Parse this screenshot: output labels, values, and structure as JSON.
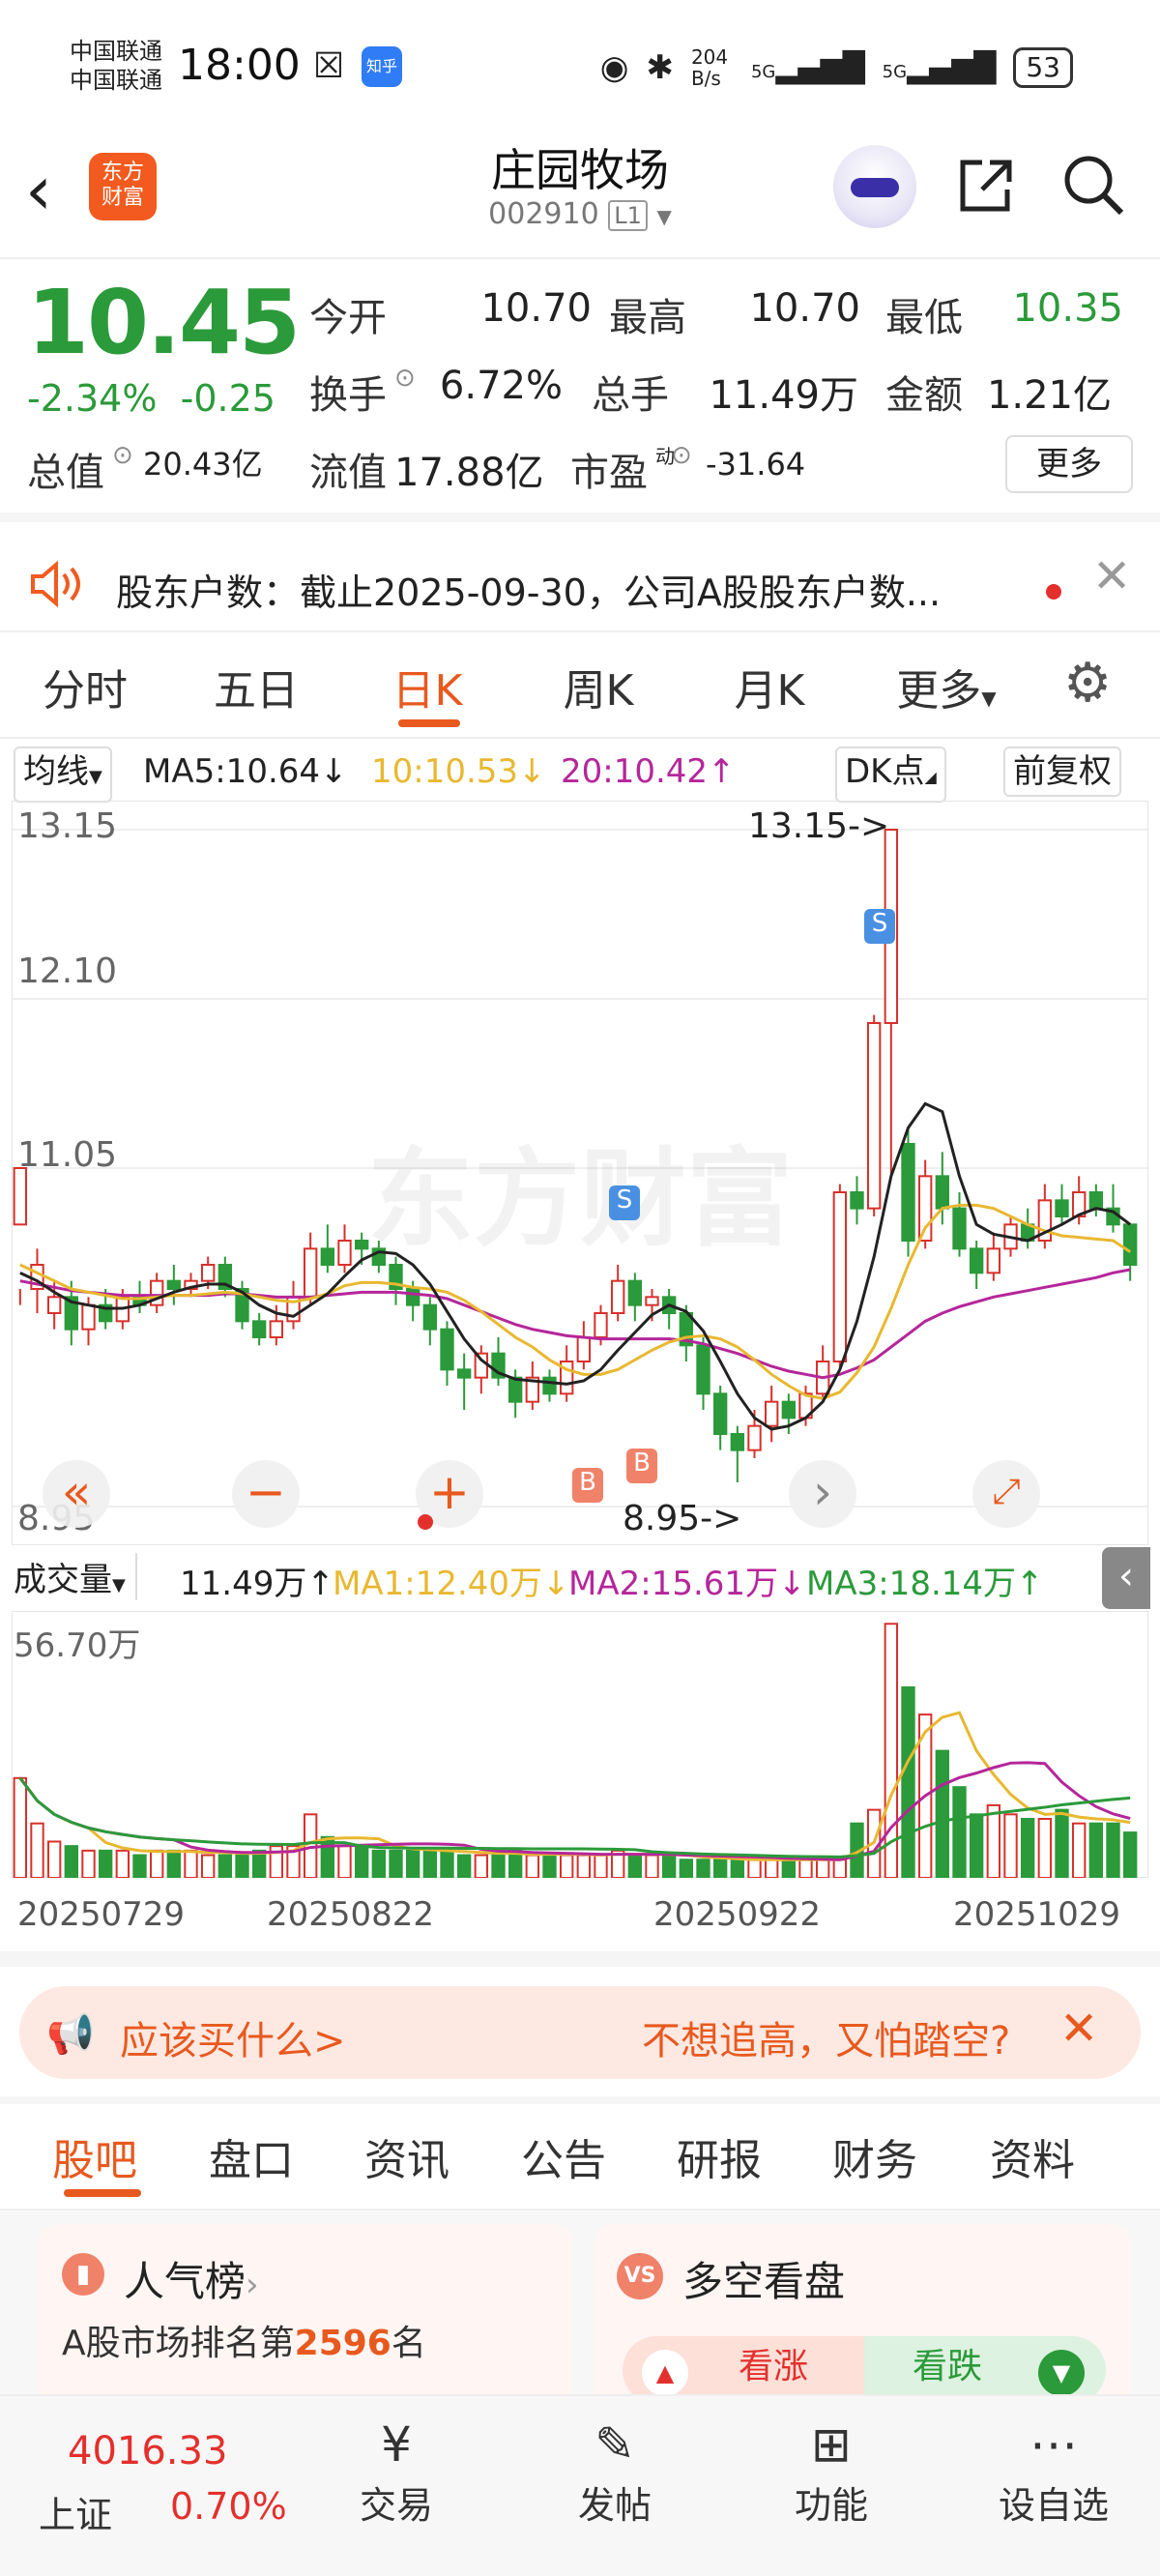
{
  "status_bar": {
    "carrier1": "中国联通",
    "carrier2": "中国联通",
    "time": "18:00",
    "zhihu": "知乎",
    "net_speed": "204 B/s",
    "sig1": "5G",
    "sig2": "5G",
    "battery": "53"
  },
  "header": {
    "logo_text": "东方财富",
    "stock_name": "庄园牧场",
    "stock_code": "002910",
    "level": "L1"
  },
  "quote": {
    "price": "10.45",
    "change_pct": "-2.34%",
    "change_amt": "-0.25",
    "open_label": "今开",
    "open": "10.70",
    "high_label": "最高",
    "high": "10.70",
    "low_label": "最低",
    "low": "10.35",
    "turnover_label": "换手",
    "turnover": "6.72%",
    "volume_label": "总手",
    "volume": "11.49万",
    "amount_label": "金额",
    "amount": "1.21亿",
    "mcap_label": "总值",
    "mcap": "20.43亿",
    "float_label": "流值",
    "float": "17.88亿",
    "pe_label": "市盈",
    "pe_sup": "动",
    "pe": "-31.64",
    "more": "更多"
  },
  "notice": {
    "text": "股东户数：截止2025-09-30，公司A股股东户数..."
  },
  "tabs": [
    "分时",
    "五日",
    "日K",
    "周K",
    "月K",
    "更多"
  ],
  "kline_header": {
    "selector": "均线",
    "ma5": "MA5:10.64",
    "ma10": "10:10.53",
    "ma20": "20:10.42",
    "dk": "DK点",
    "adjust": "前复权"
  },
  "chart_labels": {
    "y_top": "13.15",
    "y_2": "12.10",
    "y_3": "11.05",
    "y_bottom": "8.95",
    "high_marker": "13.15->",
    "low_marker": "8.95->",
    "watermark": "东方财富",
    "s_marker": "S",
    "b_marker": "B"
  },
  "volume_header": {
    "selector": "成交量",
    "vol": "11.49万",
    "ma1": "MA1:12.40万",
    "ma2": "MA2:15.61万",
    "ma3": "MA3:18.14万",
    "max": "56.70万"
  },
  "dates": [
    "20250729",
    "20250822",
    "20250922",
    "20251029"
  ],
  "chart_data": {
    "type": "candlestick",
    "ylim": [
      8.95,
      13.15
    ],
    "candles": [
      [
        10.7,
        11.05,
        10.3,
        10.2
      ],
      [
        10.3,
        10.45,
        10.15,
        10.55
      ],
      [
        10.15,
        10.25,
        10.05,
        10.35
      ],
      [
        10.25,
        10.05,
        9.95,
        10.35
      ],
      [
        10.05,
        10.2,
        9.95,
        10.25
      ],
      [
        10.2,
        10.1,
        10.05,
        10.3
      ],
      [
        10.1,
        10.25,
        10.05,
        10.3
      ],
      [
        10.25,
        10.2,
        10.15,
        10.35
      ],
      [
        10.2,
        10.35,
        10.15,
        10.4
      ],
      [
        10.35,
        10.3,
        10.2,
        10.45
      ],
      [
        10.3,
        10.35,
        10.25,
        10.4
      ],
      [
        10.35,
        10.45,
        10.3,
        10.5
      ],
      [
        10.45,
        10.3,
        10.25,
        10.5
      ],
      [
        10.3,
        10.1,
        10.05,
        10.35
      ],
      [
        10.1,
        10.0,
        9.95,
        10.15
      ],
      [
        10.0,
        10.1,
        9.95,
        10.2
      ],
      [
        10.1,
        10.25,
        10.05,
        10.35
      ],
      [
        10.25,
        10.55,
        10.2,
        10.65
      ],
      [
        10.55,
        10.45,
        10.4,
        10.7
      ],
      [
        10.45,
        10.6,
        10.4,
        10.7
      ],
      [
        10.6,
        10.55,
        10.45,
        10.65
      ],
      [
        10.55,
        10.45,
        10.4,
        10.6
      ],
      [
        10.45,
        10.3,
        10.2,
        10.5
      ],
      [
        10.3,
        10.2,
        10.1,
        10.35
      ],
      [
        10.2,
        10.05,
        9.95,
        10.25
      ],
      [
        10.05,
        9.8,
        9.7,
        10.1
      ],
      [
        9.8,
        9.75,
        9.55,
        9.9
      ],
      [
        9.75,
        9.9,
        9.65,
        9.95
      ],
      [
        9.9,
        9.75,
        9.7,
        10.0
      ],
      [
        9.75,
        9.6,
        9.5,
        9.8
      ],
      [
        9.6,
        9.75,
        9.55,
        9.85
      ],
      [
        9.75,
        9.65,
        9.6,
        9.8
      ],
      [
        9.65,
        9.85,
        9.6,
        9.95
      ],
      [
        9.85,
        10.0,
        9.8,
        10.1
      ],
      [
        10.0,
        10.15,
        9.95,
        10.2
      ],
      [
        10.15,
        10.35,
        10.1,
        10.45
      ],
      [
        10.35,
        10.2,
        10.1,
        10.4
      ],
      [
        10.2,
        10.25,
        10.1,
        10.3
      ],
      [
        10.25,
        10.15,
        10.05,
        10.3
      ],
      [
        10.15,
        9.95,
        9.85,
        10.2
      ],
      [
        9.95,
        9.65,
        9.55,
        10.0
      ],
      [
        9.65,
        9.4,
        9.3,
        9.7
      ],
      [
        9.4,
        9.3,
        9.1,
        9.45
      ],
      [
        9.3,
        9.45,
        9.25,
        9.55
      ],
      [
        9.45,
        9.6,
        9.35,
        9.7
      ],
      [
        9.6,
        9.5,
        9.4,
        9.65
      ],
      [
        9.5,
        9.65,
        9.45,
        9.7
      ],
      [
        9.65,
        9.85,
        9.6,
        9.95
      ],
      [
        9.85,
        10.9,
        9.8,
        10.95
      ],
      [
        10.9,
        10.8,
        10.7,
        11.0
      ],
      [
        10.8,
        11.95,
        10.75,
        12.0
      ],
      [
        11.95,
        13.15,
        11.0,
        13.15
      ],
      [
        11.2,
        10.6,
        10.5,
        11.3
      ],
      [
        10.6,
        11.0,
        10.55,
        11.1
      ],
      [
        11.0,
        10.8,
        10.7,
        11.15
      ],
      [
        10.8,
        10.55,
        10.5,
        10.9
      ],
      [
        10.55,
        10.4,
        10.3,
        10.6
      ],
      [
        10.4,
        10.55,
        10.35,
        10.65
      ],
      [
        10.55,
        10.7,
        10.5,
        10.75
      ],
      [
        10.7,
        10.6,
        10.55,
        10.8
      ],
      [
        10.6,
        10.85,
        10.55,
        10.95
      ],
      [
        10.85,
        10.75,
        10.7,
        10.95
      ],
      [
        10.75,
        10.9,
        10.7,
        11.0
      ],
      [
        10.9,
        10.8,
        10.75,
        10.95
      ],
      [
        10.8,
        10.7,
        10.65,
        10.95
      ],
      [
        10.7,
        10.45,
        10.35,
        10.7
      ]
    ],
    "ma5": [
      10.4,
      10.35,
      10.28,
      10.22,
      10.2,
      10.18,
      10.18,
      10.2,
      10.24,
      10.28,
      10.31,
      10.33,
      10.33,
      10.28,
      10.2,
      10.15,
      10.13,
      10.2,
      10.27,
      10.38,
      10.48,
      10.53,
      10.52,
      10.45,
      10.33,
      10.16,
      9.99,
      9.86,
      9.78,
      9.74,
      9.73,
      9.72,
      9.71,
      9.73,
      9.8,
      9.92,
      10.03,
      10.14,
      10.2,
      10.16,
      10.04,
      9.85,
      9.65,
      9.5,
      9.43,
      9.45,
      9.5,
      9.6,
      9.8,
      10.1,
      10.5,
      11.0,
      11.3,
      11.45,
      11.4,
      11.0,
      10.7,
      10.64,
      10.62,
      10.6,
      10.65,
      10.7,
      10.76,
      10.8,
      10.78,
      10.7
    ],
    "ma10": [
      10.45,
      10.4,
      10.35,
      10.3,
      10.28,
      10.26,
      10.24,
      10.24,
      10.25,
      10.26,
      10.26,
      10.27,
      10.28,
      10.27,
      10.25,
      10.23,
      10.22,
      10.24,
      10.27,
      10.32,
      10.34,
      10.34,
      10.33,
      10.31,
      10.3,
      10.28,
      10.23,
      10.16,
      10.08,
      10.0,
      9.94,
      9.86,
      9.8,
      9.77,
      9.77,
      9.8,
      9.86,
      9.92,
      9.97,
      10.0,
      10.01,
      9.99,
      9.94,
      9.86,
      9.77,
      9.7,
      9.64,
      9.62,
      9.66,
      9.78,
      9.94,
      10.18,
      10.45,
      10.68,
      10.8,
      10.82,
      10.82,
      10.8,
      10.75,
      10.7,
      10.66,
      10.63,
      10.62,
      10.61,
      10.6,
      10.53
    ],
    "ma20": [
      10.35,
      10.33,
      10.31,
      10.29,
      10.28,
      10.27,
      10.26,
      10.26,
      10.26,
      10.26,
      10.26,
      10.26,
      10.27,
      10.27,
      10.26,
      10.25,
      10.25,
      10.25,
      10.26,
      10.27,
      10.28,
      10.28,
      10.28,
      10.27,
      10.26,
      10.24,
      10.2,
      10.16,
      10.12,
      10.08,
      10.05,
      10.03,
      10.01,
      10.0,
      9.99,
      9.99,
      9.99,
      9.99,
      9.99,
      9.98,
      9.96,
      9.93,
      9.9,
      9.86,
      9.82,
      9.79,
      9.77,
      9.75,
      9.77,
      9.81,
      9.86,
      9.94,
      10.02,
      10.1,
      10.15,
      10.19,
      10.22,
      10.25,
      10.27,
      10.29,
      10.31,
      10.33,
      10.35,
      10.37,
      10.4,
      10.42
    ],
    "volume": [
      22,
      12,
      8,
      7,
      6,
      6,
      6,
      5,
      6,
      6,
      6,
      5,
      5,
      5,
      6,
      7,
      7,
      14,
      9,
      7,
      7,
      6,
      6,
      6,
      6,
      6,
      5,
      5,
      5,
      6,
      5,
      5,
      5,
      5,
      5,
      6,
      5,
      5,
      5,
      4,
      4,
      4,
      4,
      4,
      4,
      4,
      4,
      4,
      4,
      12,
      15,
      56,
      42,
      36,
      28,
      20,
      14,
      16,
      14,
      13,
      13,
      15,
      12,
      12,
      12,
      10
    ],
    "vol_ylim": [
      0,
      56.7
    ]
  },
  "ad": {
    "left": "应该买什么>",
    "right": "不想追高，又怕踏空?"
  },
  "subtabs": [
    "股吧",
    "盘口",
    "资讯",
    "公告",
    "研报",
    "财务",
    "资料"
  ],
  "cards": {
    "rank_title": "人气榜",
    "rank_text": "A股市场排名第",
    "rank_num": "2596",
    "rank_suffix": "名",
    "vs_title": "多空看盘",
    "vs_icon": "VS",
    "bull": "看涨",
    "bear": "看跌"
  },
  "bottom_nav": {
    "index_value": "4016.33",
    "index_name": "上证",
    "index_chg": "0.70%",
    "trade": "交易",
    "post": "发帖",
    "func": "功能",
    "watch": "设自选"
  }
}
